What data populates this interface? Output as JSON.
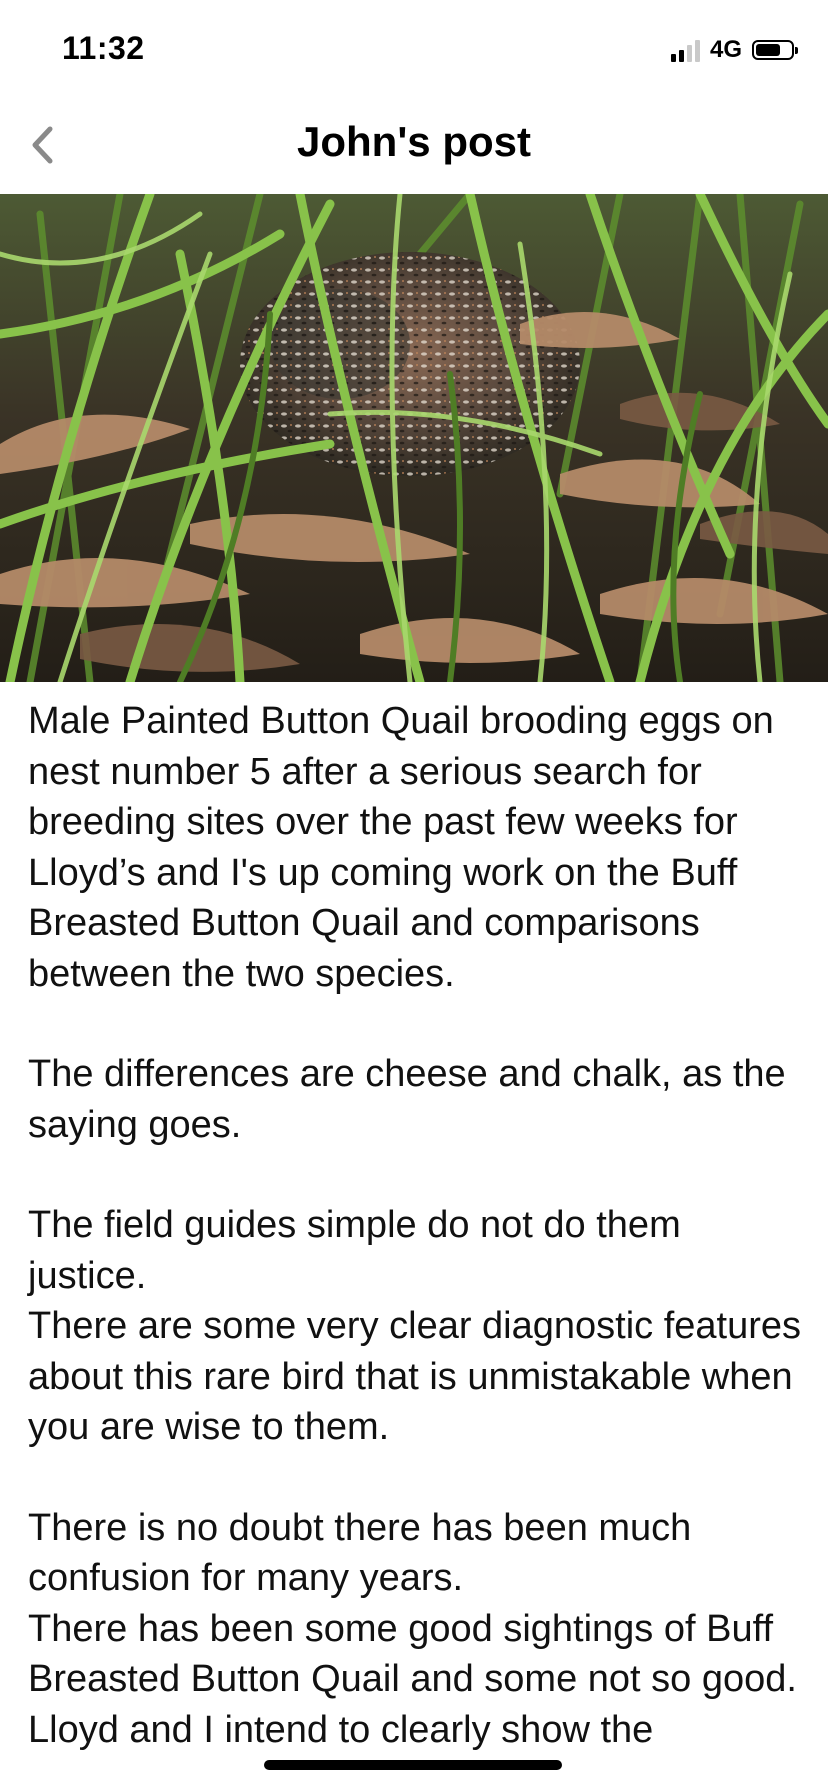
{
  "status_bar": {
    "time": "11:32",
    "network": "4G",
    "signal_bars_active": 2,
    "signal_bars_total": 4,
    "battery_icon": "battery-icon"
  },
  "nav": {
    "back_icon": "chevron-left-icon",
    "title": "John's post"
  },
  "post": {
    "paragraphs": [
      "Male Painted Button Quail brooding eggs on nest number 5 after a serious search for breeding sites over the past few weeks for Lloyd’s and I's up coming work on the Buff Breasted Button Quail and comparisons between the two species.",
      "The differences are cheese and chalk, as the saying goes.",
      "The field guides simple do not do them justice.",
      "There are some very clear diagnostic features about this rare bird that is unmistakable when you are wise to them.",
      "There is no doubt there has been much confusion for many years.",
      "There has been some good sightings of Buff Breasted Button Quail and some not so good.",
      "Lloyd and I intend to clearly show the"
    ]
  },
  "colors": {
    "text": "#111111",
    "background": "#ffffff",
    "grass_green": "#6fae3a",
    "leaf_brown": "#b48a68"
  }
}
